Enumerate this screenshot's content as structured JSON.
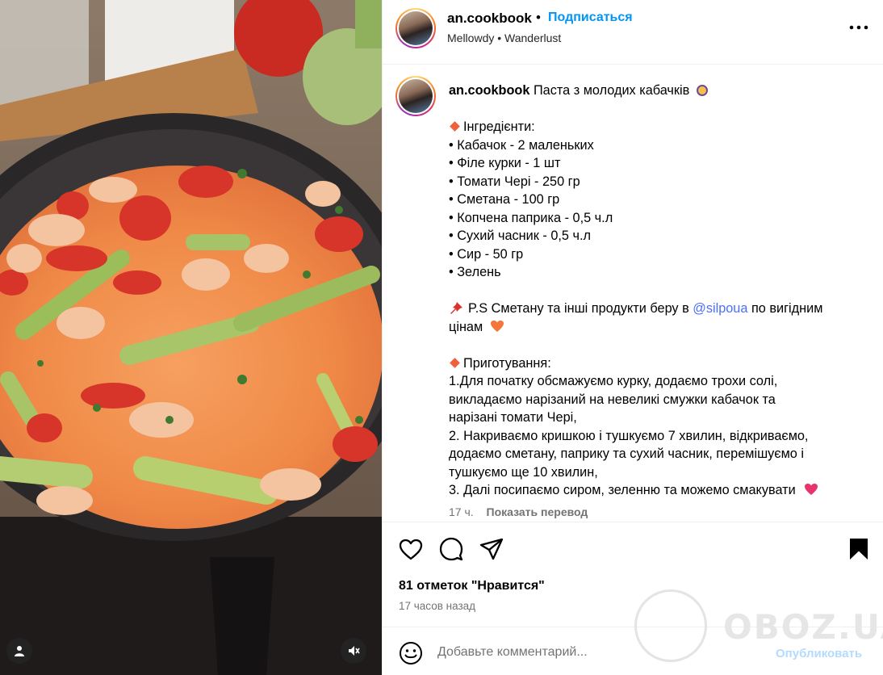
{
  "post": {
    "username": "an.cookbook",
    "follow_label": "Подписаться",
    "music": "Mellowdy • Wanderlust"
  },
  "caption": {
    "username": "an.cookbook",
    "title": "Паста з молодих кабачків",
    "ingredients_header": "Інгредієнти:",
    "ingredients": [
      "• Кабачок - 2 маленьких",
      "• Філе курки - 1 шт",
      "• Томати Чері - 250 гр",
      "• Сметана - 100 гр",
      "• Копчена паприка - 0,5 ч.л",
      "• Сухий часник - 0,5 ч.л",
      "• Сир - 50 гр",
      "• Зелень"
    ],
    "ps_prefix": "P.S Сметану та інші продукти беру в",
    "mention": "@silpoua",
    "ps_suffix": "по вигідним",
    "ps_line2": "цінам",
    "method_header": "Приготування:",
    "method_lines": [
      "1.Для початку обсмажуємо курку, додаємо трохи солі,",
      "викладаємо нарізаний на невеликі смужки кабачок та",
      "нарізані томати Чері,",
      "2. Накриваємо кришкою і тушкуємо 7 хвилин, відкриваємо,",
      "додаємо сметану, паприку та сухий часник, перемішуємо і",
      "тушкуємо ще 10 хвилин,",
      "3. Далі посипаємо сиром, зеленню та можемо смакувати"
    ],
    "time_ago": "17 ч.",
    "translate_label": "Показать перевод"
  },
  "engagement": {
    "likes": "81 отметок \"Нравится\"",
    "posted": "17 часов назад"
  },
  "comment": {
    "placeholder": "Добавьте комментарий...",
    "publish_label": "Опубликовать"
  },
  "watermark": {
    "text": "OBOZ.UA"
  },
  "colors": {
    "link": "#0095f6",
    "publish_disabled": "#b3dbff",
    "secondary_text": "#737373",
    "divider": "#efefef",
    "bullet_diamond": "#f0603a"
  },
  "icons": [
    "heart-icon",
    "comment-icon",
    "share-icon",
    "bookmark-icon",
    "more-icon",
    "emoji-icon",
    "user-tag-icon",
    "mute-icon"
  ]
}
